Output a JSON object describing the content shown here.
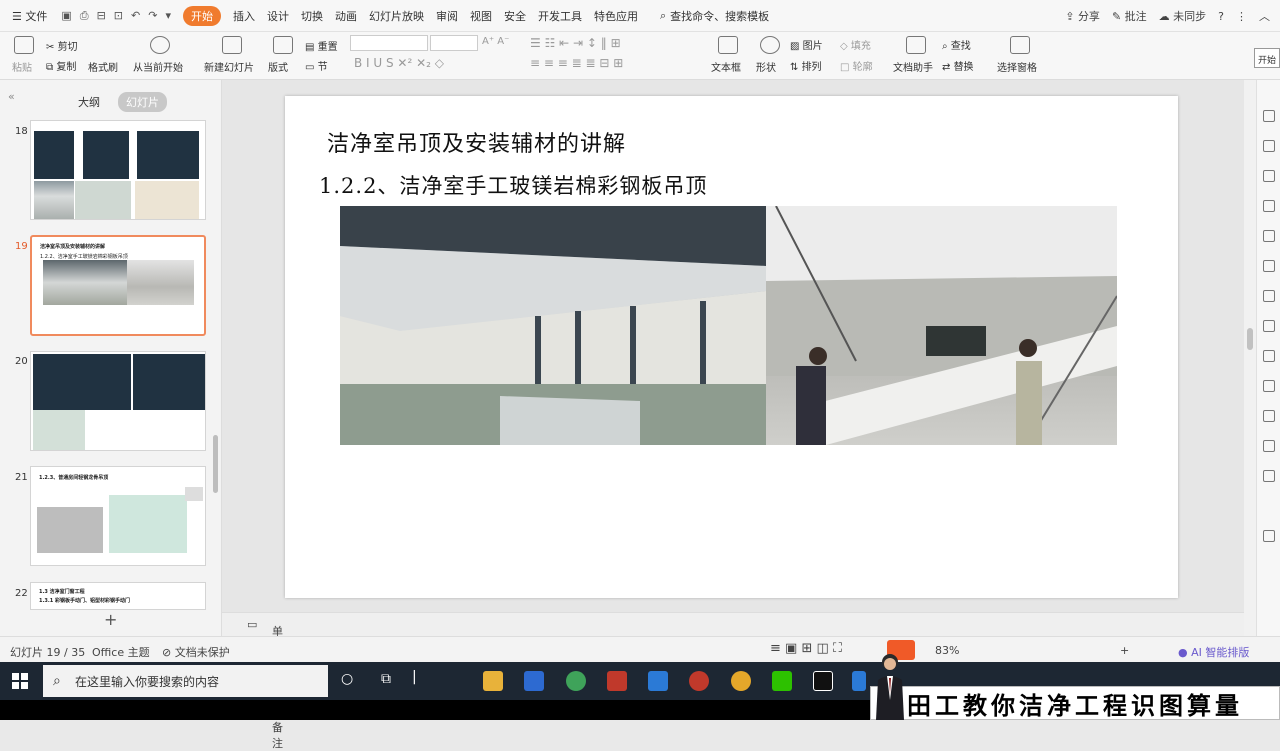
{
  "menubar": {
    "file": "文件",
    "tabs": [
      "开始",
      "插入",
      "设计",
      "切换",
      "动画",
      "幻灯片放映",
      "审阅",
      "视图",
      "安全",
      "开发工具",
      "特色应用"
    ],
    "active_tab": "开始",
    "search": "查找命令、搜索模板",
    "share": "分享",
    "comment": "批注",
    "sync": "未同步"
  },
  "ribbon": {
    "paste": "粘贴",
    "cut": "剪切",
    "copy": "复制",
    "format_painter": "格式刷",
    "play_from_current": "从当前开始",
    "new_slide": "新建幻灯片",
    "layout": "版式",
    "reset": "重置",
    "section": "节",
    "textbox": "文本框",
    "shape": "形状",
    "arrange": "排列",
    "picture": "图片",
    "fill": "填充",
    "outline": "轮廓",
    "doc_assistant": "文档助手",
    "find": "查找",
    "replace": "替换",
    "select_pane": "选择窗格",
    "side_tab": "开始"
  },
  "panel": {
    "tab_outline": "大纲",
    "tab_slides": "幻灯片",
    "slides": [
      {
        "num": "18",
        "title": "",
        "subtitle": ""
      },
      {
        "num": "19",
        "title": "洁净室吊顶及安装辅材的讲解",
        "subtitle": "1.2.2、洁净室手工玻镁岩棉彩钢板吊顶"
      },
      {
        "num": "20",
        "title": "",
        "subtitle": ""
      },
      {
        "num": "21",
        "title": "1.2.3、普通房间轻钢龙骨吊顶",
        "subtitle": ""
      },
      {
        "num": "22",
        "title": "1.3 洁净室门窗工程",
        "subtitle": "1.3.1 彩钢板手动门、铝型材彩钢手动门"
      }
    ]
  },
  "slide": {
    "title": "洁净室吊顶及安装辅材的讲解",
    "subtitle": "1.2.2、洁净室手工玻镁岩棉彩钢板吊顶"
  },
  "notes": {
    "placeholder": "单击此处添加备注"
  },
  "status": {
    "slide_index": "幻灯片 19 / 35",
    "theme": "Office 主题",
    "protection": "文档未保护",
    "zoom": "83%",
    "ai": "AI 智能排版"
  },
  "taskbar": {
    "search_placeholder": "在这里输入你要搜索的内容"
  },
  "banner": {
    "text": "田工教你洁净工程识图算量"
  }
}
